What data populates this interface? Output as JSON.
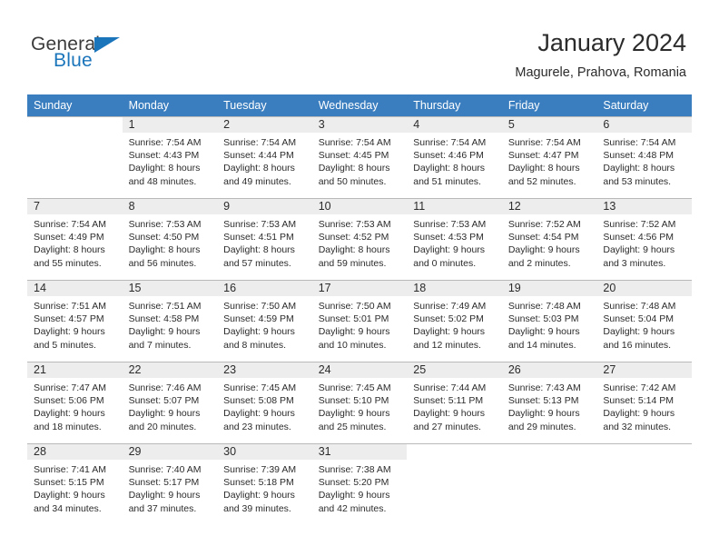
{
  "brand": {
    "name_top": "General",
    "name_bottom": "Blue",
    "color_blue": "#1b75bb",
    "color_dark": "#3b3b3b",
    "triangle_icon": "triangle-icon"
  },
  "header": {
    "title": "January 2024",
    "location": "Magurele, Prahova, Romania"
  },
  "theme": {
    "header_row_bg": "#3a7ebf",
    "daynum_band_bg": "#ededed",
    "grid_line": "#b9b9b9",
    "text": "#2b2b2b"
  },
  "weekday_headers": [
    "Sunday",
    "Monday",
    "Tuesday",
    "Wednesday",
    "Thursday",
    "Friday",
    "Saturday"
  ],
  "weeks": [
    [
      {
        "day": "",
        "lines": []
      },
      {
        "day": "1",
        "lines": [
          "Sunrise: 7:54 AM",
          "Sunset: 4:43 PM",
          "Daylight: 8 hours",
          "and 48 minutes."
        ]
      },
      {
        "day": "2",
        "lines": [
          "Sunrise: 7:54 AM",
          "Sunset: 4:44 PM",
          "Daylight: 8 hours",
          "and 49 minutes."
        ]
      },
      {
        "day": "3",
        "lines": [
          "Sunrise: 7:54 AM",
          "Sunset: 4:45 PM",
          "Daylight: 8 hours",
          "and 50 minutes."
        ]
      },
      {
        "day": "4",
        "lines": [
          "Sunrise: 7:54 AM",
          "Sunset: 4:46 PM",
          "Daylight: 8 hours",
          "and 51 minutes."
        ]
      },
      {
        "day": "5",
        "lines": [
          "Sunrise: 7:54 AM",
          "Sunset: 4:47 PM",
          "Daylight: 8 hours",
          "and 52 minutes."
        ]
      },
      {
        "day": "6",
        "lines": [
          "Sunrise: 7:54 AM",
          "Sunset: 4:48 PM",
          "Daylight: 8 hours",
          "and 53 minutes."
        ]
      }
    ],
    [
      {
        "day": "7",
        "lines": [
          "Sunrise: 7:54 AM",
          "Sunset: 4:49 PM",
          "Daylight: 8 hours",
          "and 55 minutes."
        ]
      },
      {
        "day": "8",
        "lines": [
          "Sunrise: 7:53 AM",
          "Sunset: 4:50 PM",
          "Daylight: 8 hours",
          "and 56 minutes."
        ]
      },
      {
        "day": "9",
        "lines": [
          "Sunrise: 7:53 AM",
          "Sunset: 4:51 PM",
          "Daylight: 8 hours",
          "and 57 minutes."
        ]
      },
      {
        "day": "10",
        "lines": [
          "Sunrise: 7:53 AM",
          "Sunset: 4:52 PM",
          "Daylight: 8 hours",
          "and 59 minutes."
        ]
      },
      {
        "day": "11",
        "lines": [
          "Sunrise: 7:53 AM",
          "Sunset: 4:53 PM",
          "Daylight: 9 hours",
          "and 0 minutes."
        ]
      },
      {
        "day": "12",
        "lines": [
          "Sunrise: 7:52 AM",
          "Sunset: 4:54 PM",
          "Daylight: 9 hours",
          "and 2 minutes."
        ]
      },
      {
        "day": "13",
        "lines": [
          "Sunrise: 7:52 AM",
          "Sunset: 4:56 PM",
          "Daylight: 9 hours",
          "and 3 minutes."
        ]
      }
    ],
    [
      {
        "day": "14",
        "lines": [
          "Sunrise: 7:51 AM",
          "Sunset: 4:57 PM",
          "Daylight: 9 hours",
          "and 5 minutes."
        ]
      },
      {
        "day": "15",
        "lines": [
          "Sunrise: 7:51 AM",
          "Sunset: 4:58 PM",
          "Daylight: 9 hours",
          "and 7 minutes."
        ]
      },
      {
        "day": "16",
        "lines": [
          "Sunrise: 7:50 AM",
          "Sunset: 4:59 PM",
          "Daylight: 9 hours",
          "and 8 minutes."
        ]
      },
      {
        "day": "17",
        "lines": [
          "Sunrise: 7:50 AM",
          "Sunset: 5:01 PM",
          "Daylight: 9 hours",
          "and 10 minutes."
        ]
      },
      {
        "day": "18",
        "lines": [
          "Sunrise: 7:49 AM",
          "Sunset: 5:02 PM",
          "Daylight: 9 hours",
          "and 12 minutes."
        ]
      },
      {
        "day": "19",
        "lines": [
          "Sunrise: 7:48 AM",
          "Sunset: 5:03 PM",
          "Daylight: 9 hours",
          "and 14 minutes."
        ]
      },
      {
        "day": "20",
        "lines": [
          "Sunrise: 7:48 AM",
          "Sunset: 5:04 PM",
          "Daylight: 9 hours",
          "and 16 minutes."
        ]
      }
    ],
    [
      {
        "day": "21",
        "lines": [
          "Sunrise: 7:47 AM",
          "Sunset: 5:06 PM",
          "Daylight: 9 hours",
          "and 18 minutes."
        ]
      },
      {
        "day": "22",
        "lines": [
          "Sunrise: 7:46 AM",
          "Sunset: 5:07 PM",
          "Daylight: 9 hours",
          "and 20 minutes."
        ]
      },
      {
        "day": "23",
        "lines": [
          "Sunrise: 7:45 AM",
          "Sunset: 5:08 PM",
          "Daylight: 9 hours",
          "and 23 minutes."
        ]
      },
      {
        "day": "24",
        "lines": [
          "Sunrise: 7:45 AM",
          "Sunset: 5:10 PM",
          "Daylight: 9 hours",
          "and 25 minutes."
        ]
      },
      {
        "day": "25",
        "lines": [
          "Sunrise: 7:44 AM",
          "Sunset: 5:11 PM",
          "Daylight: 9 hours",
          "and 27 minutes."
        ]
      },
      {
        "day": "26",
        "lines": [
          "Sunrise: 7:43 AM",
          "Sunset: 5:13 PM",
          "Daylight: 9 hours",
          "and 29 minutes."
        ]
      },
      {
        "day": "27",
        "lines": [
          "Sunrise: 7:42 AM",
          "Sunset: 5:14 PM",
          "Daylight: 9 hours",
          "and 32 minutes."
        ]
      }
    ],
    [
      {
        "day": "28",
        "lines": [
          "Sunrise: 7:41 AM",
          "Sunset: 5:15 PM",
          "Daylight: 9 hours",
          "and 34 minutes."
        ]
      },
      {
        "day": "29",
        "lines": [
          "Sunrise: 7:40 AM",
          "Sunset: 5:17 PM",
          "Daylight: 9 hours",
          "and 37 minutes."
        ]
      },
      {
        "day": "30",
        "lines": [
          "Sunrise: 7:39 AM",
          "Sunset: 5:18 PM",
          "Daylight: 9 hours",
          "and 39 minutes."
        ]
      },
      {
        "day": "31",
        "lines": [
          "Sunrise: 7:38 AM",
          "Sunset: 5:20 PM",
          "Daylight: 9 hours",
          "and 42 minutes."
        ]
      },
      {
        "day": "",
        "lines": []
      },
      {
        "day": "",
        "lines": []
      },
      {
        "day": "",
        "lines": []
      }
    ]
  ]
}
